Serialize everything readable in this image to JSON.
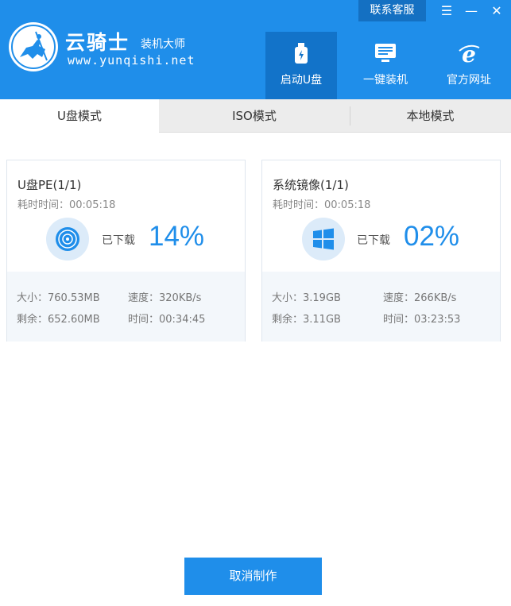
{
  "header": {
    "brand_name": "云骑士",
    "brand_sub": "装机大师",
    "brand_url": "www.yunqishi.net",
    "contact_label": "联系客服",
    "menu_glyph": "☰",
    "minimize_glyph": "—",
    "close_glyph": "✕",
    "nav": [
      {
        "label": "启动U盘",
        "icon": "usb-drive-icon",
        "active": true
      },
      {
        "label": "一键装机",
        "icon": "monitor-icon",
        "active": false
      },
      {
        "label": "官方网址",
        "icon": "ie-browser-icon",
        "active": false
      }
    ],
    "brand_color": "#1f8eea"
  },
  "tabs": [
    {
      "label": "U盘模式",
      "active": true
    },
    {
      "label": "ISO模式",
      "active": false
    },
    {
      "label": "本地模式",
      "active": false
    }
  ],
  "cards": [
    {
      "title": "U盘PE(1/1)",
      "elapsed": "耗时时间：00:05:18",
      "icon": "disc-icon",
      "download_label": "已下载",
      "percent": "14%",
      "size": "大小：760.53MB",
      "speed": "速度：320KB/s",
      "remaining": "剩余：652.60MB",
      "time_left": "时间：00:34:45"
    },
    {
      "title": "系统镜像(1/1)",
      "elapsed": "耗时时间：00:05:18",
      "icon": "windows-logo-icon",
      "download_label": "已下载",
      "percent": "02%",
      "size": "大小：3.19GB",
      "speed": "速度：266KB/s",
      "remaining": "剩余：3.11GB",
      "time_left": "时间：03:23:53"
    }
  ],
  "cancel_label": "取消制作"
}
